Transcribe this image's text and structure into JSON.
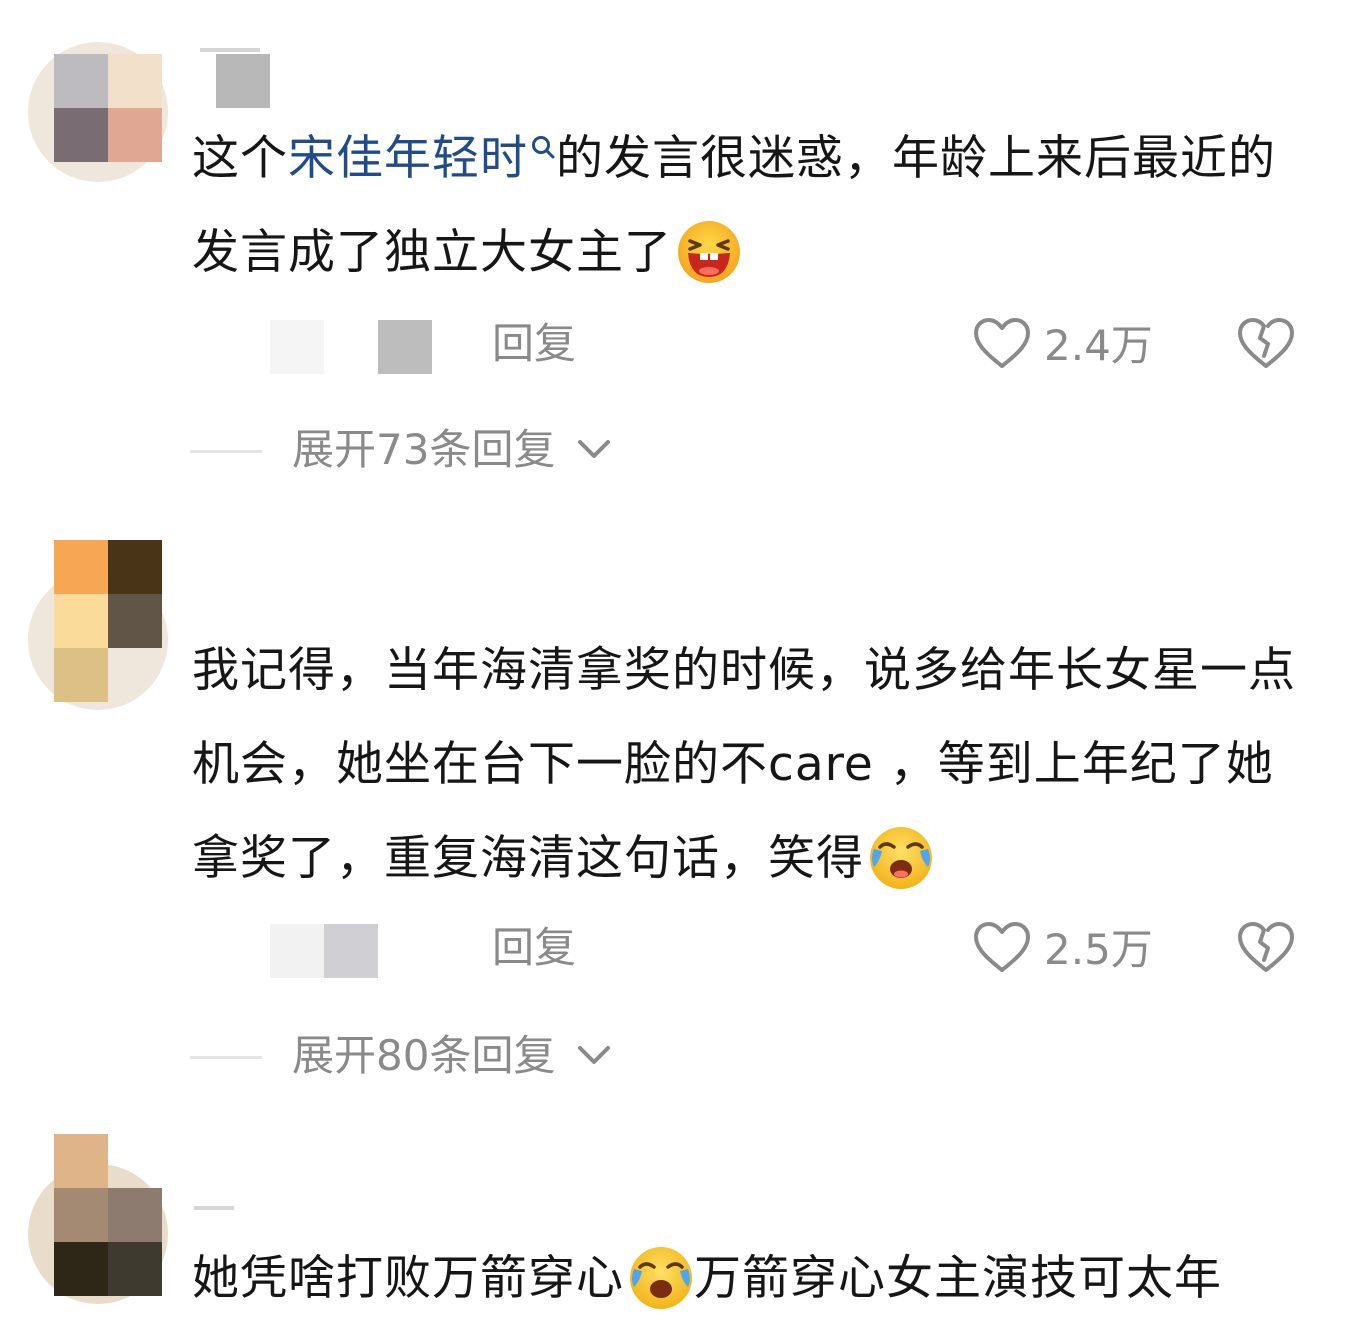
{
  "comments": [
    {
      "text_before": "这个",
      "link_text": "宋佳年轻时",
      "text_after_link": "的发言很迷惑，年龄上来后最近的发言成了独立大女主了",
      "emoji": "laughing-emoji",
      "reply_label": "回复",
      "like_count": "2.4万",
      "expand_label": "展开73条回复"
    },
    {
      "text": "我记得，当年海清拿奖的时候，说多给年长女星一点机会，她坐在台下一脸的不care ，等到上年纪了她拿奖了，重复海清这句话，笑得",
      "emoji": "tears-of-joy-emoji",
      "reply_label": "回复",
      "like_count": "2.5万",
      "expand_label": "展开80条回复"
    },
    {
      "text_part1": "她凭啥打败万箭穿心",
      "emoji": "tears-of-joy-emoji",
      "text_part2": "万箭穿心女主演技可太年"
    }
  ],
  "icons": {
    "like": "heart-outline-icon",
    "dislike": "broken-heart-icon",
    "search": "search-icon",
    "expand": "chevron-down-icon"
  },
  "colors": {
    "text": "#161616",
    "link": "#214c8a",
    "muted": "#8a8a8a"
  }
}
